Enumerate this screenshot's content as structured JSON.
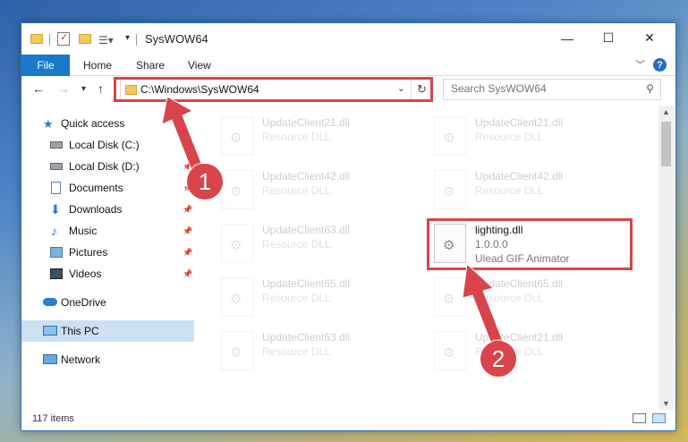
{
  "window": {
    "title": "SysWOW64",
    "controls": {
      "minimize": "—",
      "maximize": "☐",
      "close": "✕"
    }
  },
  "ribbon": {
    "file_tab": "File",
    "tabs": [
      "Home",
      "Share",
      "View"
    ],
    "help": "?"
  },
  "nav": {
    "address": "C:\\Windows\\SysWOW64",
    "search_placeholder": "Search SysWOW64"
  },
  "sidebar": {
    "items": [
      {
        "label": "Quick access",
        "icon": "star-icon"
      },
      {
        "label": "Local Disk (C:)",
        "icon": "drive-icon",
        "pinned": true
      },
      {
        "label": "Local Disk (D:)",
        "icon": "drive-icon",
        "pinned": true
      },
      {
        "label": "Documents",
        "icon": "documents-icon",
        "pinned": true
      },
      {
        "label": "Downloads",
        "icon": "downloads-icon",
        "pinned": true
      },
      {
        "label": "Music",
        "icon": "music-icon",
        "pinned": true
      },
      {
        "label": "Pictures",
        "icon": "pictures-icon",
        "pinned": true
      },
      {
        "label": "Videos",
        "icon": "videos-icon",
        "pinned": true
      },
      {
        "label": "OneDrive",
        "icon": "cloud-icon"
      },
      {
        "label": "This PC",
        "icon": "computer-icon",
        "selected": true
      },
      {
        "label": "Network",
        "icon": "network-icon"
      }
    ]
  },
  "files": [
    {
      "name": "UpdateClient21.dll",
      "l2": "Resource DLL",
      "l3": ""
    },
    {
      "name": "UpdateClient21.dll",
      "l2": "Resource DLL",
      "l3": ""
    },
    {
      "name": "UpdateClient42.dll",
      "l2": "Resource DLL",
      "l3": ""
    },
    {
      "name": "UpdateClient42.dll",
      "l2": "Resource DLL",
      "l3": ""
    },
    {
      "name": "UpdateClient63.dll",
      "l2": "Resource DLL",
      "l3": ""
    },
    {
      "name": "lighting.dll",
      "l2": "1.0.0.0",
      "l3": "Ulead GIF Animator"
    },
    {
      "name": "UpdateClient65.dll",
      "l2": "Resource DLL",
      "l3": ""
    },
    {
      "name": "UpdateClient65.dll",
      "l2": "Resource DLL",
      "l3": ""
    },
    {
      "name": "UpdateClient63.dll",
      "l2": "Resource DLL",
      "l3": ""
    },
    {
      "name": "UpdateClient21.dll",
      "l2": "Resource DLL",
      "l3": ""
    }
  ],
  "status": {
    "item_count": "117 items"
  },
  "annotations": {
    "callout1": "1",
    "callout2": "2",
    "color": "#d9434a"
  }
}
